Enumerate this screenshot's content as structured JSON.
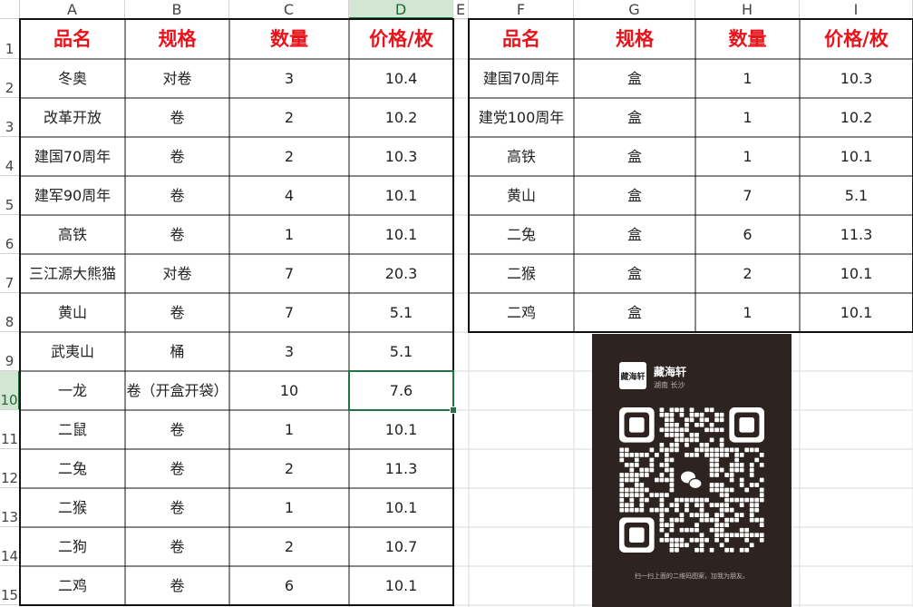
{
  "columns": [
    "A",
    "B",
    "C",
    "D",
    "E",
    "F",
    "G",
    "H",
    "I"
  ],
  "selected_column": "D",
  "rows": [
    "1",
    "2",
    "3",
    "4",
    "5",
    "6",
    "7",
    "8",
    "9",
    "10",
    "11",
    "12",
    "13",
    "14",
    "15"
  ],
  "selected_row": "10",
  "left_table": {
    "headers": [
      "品名",
      "规格",
      "数量",
      "价格/枚"
    ],
    "rows": [
      [
        "冬奥",
        "对卷",
        "3",
        "10.4"
      ],
      [
        "改革开放",
        "卷",
        "2",
        "10.2"
      ],
      [
        "建国70周年",
        "卷",
        "2",
        "10.3"
      ],
      [
        "建军90周年",
        "卷",
        "4",
        "10.1"
      ],
      [
        "高铁",
        "卷",
        "1",
        "10.1"
      ],
      [
        "三江源大熊猫",
        "对卷",
        "7",
        "20.3"
      ],
      [
        "黄山",
        "卷",
        "7",
        "5.1"
      ],
      [
        "武夷山",
        "桶",
        "3",
        "5.1"
      ],
      [
        "一龙",
        "卷（开盒开袋）",
        "10",
        "7.6"
      ],
      [
        "二鼠",
        "卷",
        "1",
        "10.1"
      ],
      [
        "二兔",
        "卷",
        "2",
        "11.3"
      ],
      [
        "二猴",
        "卷",
        "1",
        "10.1"
      ],
      [
        "二狗",
        "卷",
        "2",
        "10.7"
      ],
      [
        "二鸡",
        "卷",
        "6",
        "10.1"
      ]
    ]
  },
  "right_table": {
    "headers": [
      "品名",
      "规格",
      "数量",
      "价格/枚"
    ],
    "rows": [
      [
        "建国70周年",
        "盒",
        "1",
        "10.3"
      ],
      [
        "建党100周年",
        "盒",
        "1",
        "10.2"
      ],
      [
        "高铁",
        "盒",
        "1",
        "10.1"
      ],
      [
        "黄山",
        "盒",
        "7",
        "5.1"
      ],
      [
        "二兔",
        "盒",
        "6",
        "11.3"
      ],
      [
        "二猴",
        "盒",
        "2",
        "10.1"
      ],
      [
        "二鸡",
        "盒",
        "1",
        "10.1"
      ]
    ]
  },
  "qr_card": {
    "logo_text": "藏海轩",
    "shop_name": "藏海轩",
    "location": "湖南 长沙",
    "caption": "扫一扫上面的二维码图案，加我为朋友。",
    "icon": "wechat-icon"
  },
  "colors": {
    "header_text": "#e8141b",
    "selection": "#217346",
    "card_bg": "#2d2422"
  }
}
